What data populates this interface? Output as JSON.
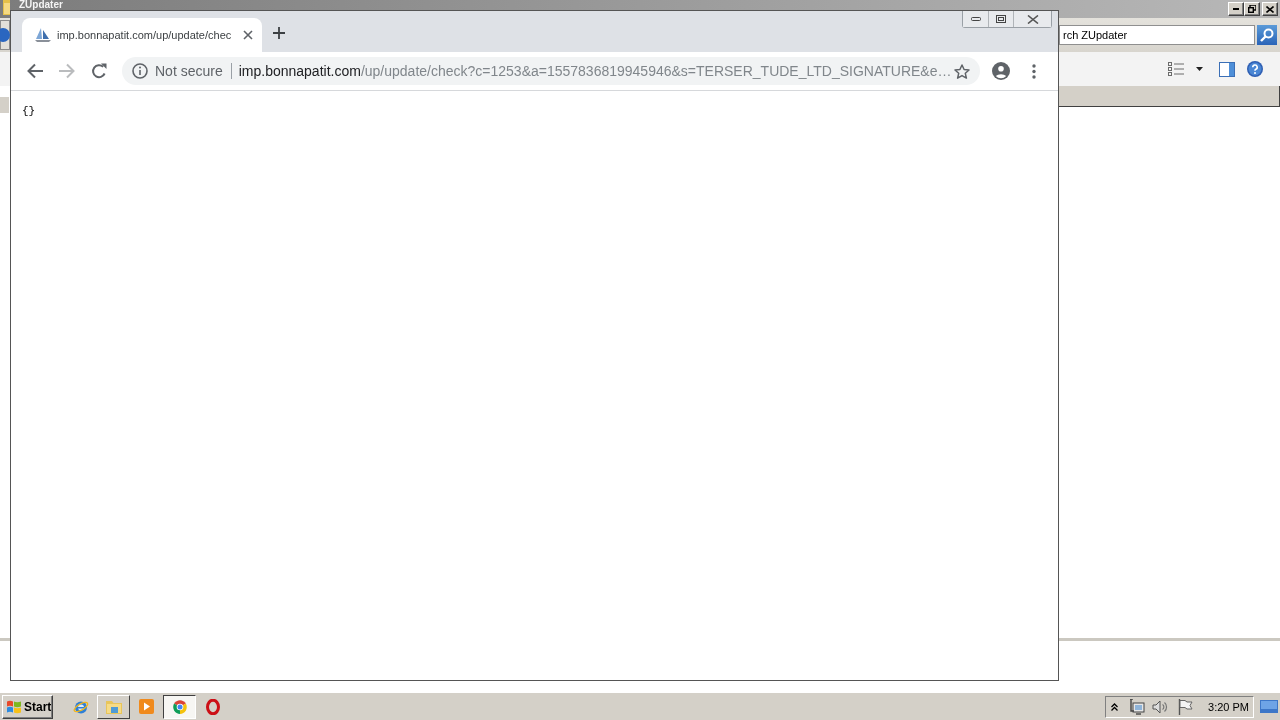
{
  "explorer": {
    "title": "ZUpdater",
    "search": {
      "placeholder": "rch ZUpdater"
    }
  },
  "browser": {
    "tabs": [
      {
        "title": "imp.bonnapatit.com/up/update/chec",
        "selected": true
      }
    ],
    "back_button": {
      "disabled": false
    },
    "forward_button": {
      "disabled": true
    },
    "omnibox": {
      "security": "Not secure",
      "host": "imp.bonnapatit.com",
      "path": "/up/update/check?c=1253&a=1557836819945946&s=TERSER_TUDE_LTD_SIGNATURE&e…",
      "bookmarked": false
    },
    "page": {
      "text": "{}"
    }
  },
  "taskbar": {
    "start": "Start",
    "apps": [
      {
        "open": false,
        "selected": false
      },
      {
        "open": true,
        "selected": false
      },
      {
        "open": false,
        "selected": false
      },
      {
        "open": true,
        "selected": true
      },
      {
        "open": false,
        "selected": false
      }
    ],
    "clock": "3:20 PM"
  }
}
